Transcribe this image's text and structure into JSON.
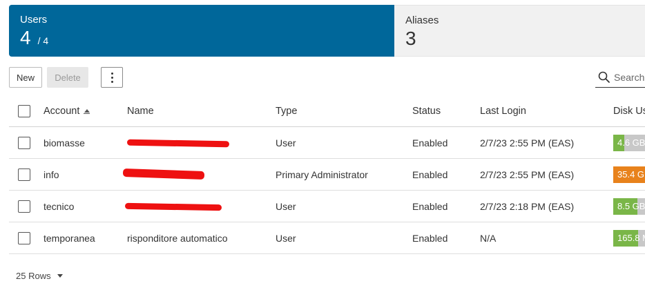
{
  "tiles": {
    "users": {
      "label": "Users",
      "count": "4",
      "total": "/ 4"
    },
    "aliases": {
      "label": "Aliases",
      "count": "3"
    }
  },
  "toolbar": {
    "new_label": "New",
    "delete_label": "Delete",
    "search_placeholder": "Search"
  },
  "table": {
    "columns": {
      "account": "Account",
      "name": "Name",
      "type": "Type",
      "status": "Status",
      "last_login": "Last Login",
      "disk_usage": "Disk Us"
    },
    "rows": [
      {
        "account": "biomasse",
        "name": "",
        "name_redacted": true,
        "type": "User",
        "status": "Enabled",
        "last_login": "2/7/23 2:55 PM (EAS)",
        "disk": "4.6 GB",
        "disk_fraction": 0.35,
        "disk_color": "#7ab648"
      },
      {
        "account": "info",
        "name": "",
        "name_redacted": true,
        "type": "Primary Administrator",
        "status": "Enabled",
        "last_login": "2/7/23 2:55 PM (EAS)",
        "disk": "35.4 G",
        "disk_fraction": 1.0,
        "disk_color": "#e8821c"
      },
      {
        "account": "tecnico",
        "name": "",
        "name_redacted": true,
        "type": "User",
        "status": "Enabled",
        "last_login": "2/7/23 2:18 PM (EAS)",
        "disk": "8.5 GB",
        "disk_fraction": 0.75,
        "disk_color": "#7ab648"
      },
      {
        "account": "temporanea",
        "name": "risponditore automatico",
        "name_redacted": false,
        "type": "User",
        "status": "Enabled",
        "last_login": "N/A",
        "disk": "165.8 M",
        "disk_fraction": 0.78,
        "disk_color": "#7ab648"
      }
    ]
  },
  "footer": {
    "rows_label": "25 Rows"
  },
  "colors": {
    "tile_active": "#00679a",
    "disk_ok": "#7ab648",
    "disk_warn": "#e8821c",
    "redaction": "#ee1111"
  }
}
